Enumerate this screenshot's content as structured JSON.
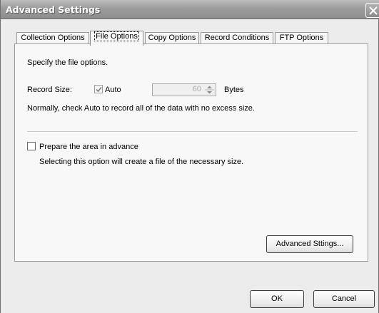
{
  "window": {
    "title": "Advanced Settings"
  },
  "tabs": [
    {
      "label": "Collection Options"
    },
    {
      "label": "File Options"
    },
    {
      "label": "Copy Options"
    },
    {
      "label": "Record Conditions"
    },
    {
      "label": "FTP Options"
    }
  ],
  "active_tab": "File Options",
  "file_options": {
    "intro": "Specify the file options.",
    "record_size_label": "Record Size:",
    "auto_checkbox": {
      "label": "Auto",
      "checked": true
    },
    "size_value": "60",
    "size_unit": "Bytes",
    "auto_hint": "Normally, check Auto to record all of the data with no excess size.",
    "prepare_checkbox": {
      "label": "Prepare the area in advance",
      "checked": false
    },
    "prepare_hint": "Selecting this option will create a file of the necessary size.",
    "advanced_button": "Advanced Sttings..."
  },
  "footer": {
    "ok_label": "OK",
    "cancel_label": "Cancel"
  }
}
